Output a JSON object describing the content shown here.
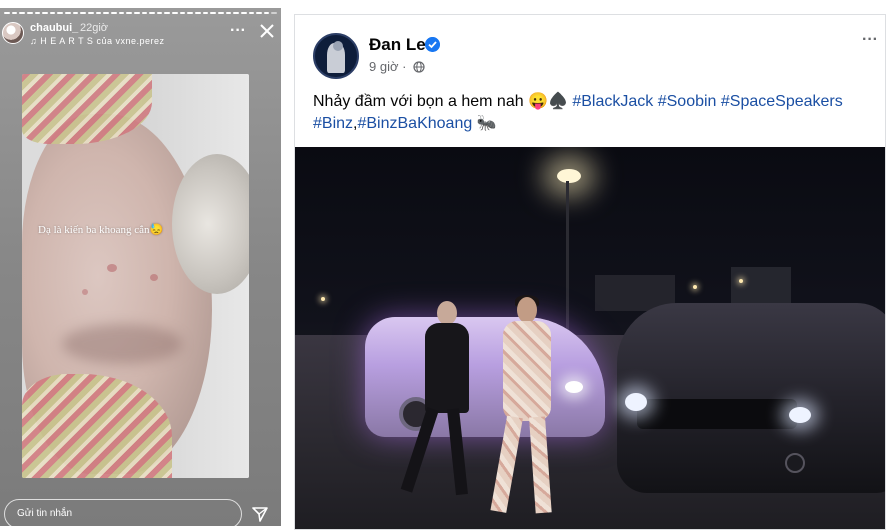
{
  "story": {
    "username": "chaubui_",
    "time": "22giờ",
    "music": "♫ H E A R T S của vxne.perez",
    "more": "···",
    "caption": "Dạ là kiến ba khoang cắn😓",
    "reply_placeholder": "Gửi tin nhắn"
  },
  "post": {
    "author": "Đan Le",
    "time": "9 giờ ·",
    "more": "···",
    "text_plain": "Nhảy đầm với bọn a hem nah 😛♠️ ",
    "tags": [
      "#BlackJack",
      "#Soobin",
      "#SpaceSpeakers",
      "#Binz",
      "#BinzBaKhoang"
    ],
    "tag_separators": [
      " ",
      " ",
      " ",
      ",",
      " 🐜"
    ]
  },
  "icons": {
    "close": "close-icon",
    "send": "send-icon",
    "verified": "verified-badge-icon",
    "globe": "globe-icon"
  },
  "colors": {
    "link": "#1b4fa3",
    "verified": "#1877f2",
    "meta_text": "#65676b"
  }
}
